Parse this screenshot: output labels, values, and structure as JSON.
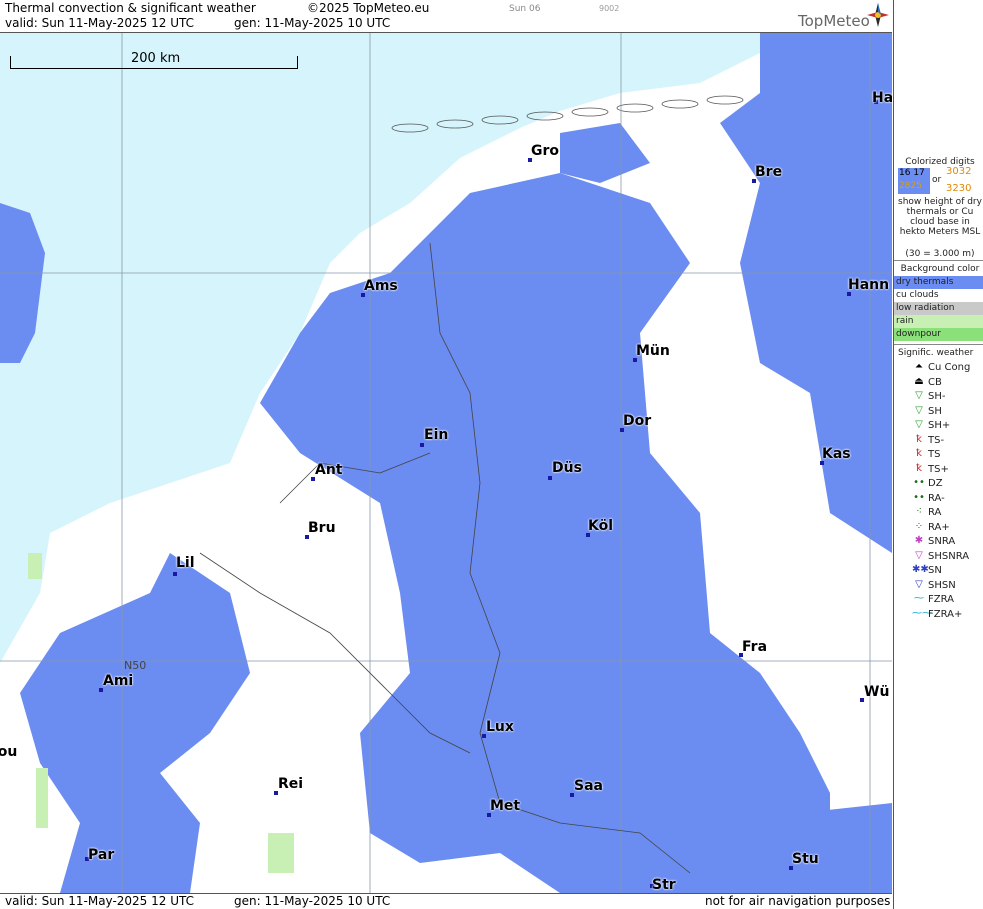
{
  "header": {
    "title": "Thermal convection & significant weather",
    "copyright": "©2025 TopMeteo.eu",
    "run": "Sun 06",
    "code": "9002",
    "valid": "valid:  Sun  11-May-2025  12 UTC",
    "generated": "gen: 11-May-2025 10 UTC"
  },
  "footer": {
    "valid": "valid:  Sun  11-May-2025  12 UTC",
    "generated": "gen: 11-May-2025 10 UTC",
    "disclaimer": "not for air navigation purposes"
  },
  "brand": {
    "name": "TopMeteo"
  },
  "scale": {
    "label": "200 km"
  },
  "map": {
    "grid_label": "N50",
    "cities": [
      {
        "name": "Ham"
      },
      {
        "name": "Gro"
      },
      {
        "name": "Bre"
      },
      {
        "name": "Ams"
      },
      {
        "name": "Hann"
      },
      {
        "name": "Mün"
      },
      {
        "name": "Ein"
      },
      {
        "name": "Dor"
      },
      {
        "name": "Ant"
      },
      {
        "name": "Düs"
      },
      {
        "name": "Kas"
      },
      {
        "name": "Bru"
      },
      {
        "name": "Köl"
      },
      {
        "name": "Lil"
      },
      {
        "name": "Fra"
      },
      {
        "name": "Ami"
      },
      {
        "name": "Lux"
      },
      {
        "name": "Wü"
      },
      {
        "name": "Rei"
      },
      {
        "name": "Saa"
      },
      {
        "name": "Met"
      },
      {
        "name": "Rou"
      },
      {
        "name": "Par"
      },
      {
        "name": "Stu"
      },
      {
        "name": "Str"
      }
    ]
  },
  "legend": {
    "colorized_title": "Colorized digits",
    "sample_left_top": "16 17",
    "sample_left_bottom": "2825",
    "sample_or": "or",
    "sample_right_top": "3032",
    "sample_right_bottom": "3230",
    "description": "show height of dry thermals or Cu cloud base in hekto Meters MSL",
    "example": "(30 = 3.000 m)",
    "background_title": "Background color",
    "backgrounds": [
      {
        "label": "dry thermals",
        "color": "#6b8cf0"
      },
      {
        "label": "cu clouds",
        "color": "#ffffff"
      },
      {
        "label": "low radiation",
        "color": "#c9c9c9"
      },
      {
        "label": "rain",
        "color": "#c8f0b4"
      },
      {
        "label": "downpour",
        "color": "#8ce07a"
      }
    ],
    "weather_title": "Signific. weather",
    "weather": [
      {
        "code": "Cu Cong",
        "icon": "cu-cong-icon",
        "glyph": "⏶",
        "color": "#000000"
      },
      {
        "code": "CB",
        "icon": "cb-icon",
        "glyph": "⏏",
        "color": "#000000"
      },
      {
        "code": "SH-",
        "icon": "shower-light-icon",
        "glyph": "▽",
        "color": "#2ca02c"
      },
      {
        "code": "SH",
        "icon": "shower-icon",
        "glyph": "▽",
        "color": "#2ca02c"
      },
      {
        "code": "SH+",
        "icon": "shower-heavy-icon",
        "glyph": "▽",
        "color": "#2ca02c"
      },
      {
        "code": "TS-",
        "icon": "thunderstorm-light-icon",
        "glyph": "ꝁ",
        "color": "#d62728"
      },
      {
        "code": "TS",
        "icon": "thunderstorm-icon",
        "glyph": "ꝁ",
        "color": "#d62728"
      },
      {
        "code": "TS+",
        "icon": "thunderstorm-heavy-icon",
        "glyph": "ꝁ",
        "color": "#d62728"
      },
      {
        "code": "DZ",
        "icon": "drizzle-icon",
        "glyph": "••",
        "color": "#1a6e1a"
      },
      {
        "code": "RA-",
        "icon": "rain-light-icon",
        "glyph": "••",
        "color": "#1a6e1a"
      },
      {
        "code": "RA",
        "icon": "rain-icon",
        "glyph": "⁖",
        "color": "#1a6e1a"
      },
      {
        "code": "RA+",
        "icon": "rain-heavy-icon",
        "glyph": "⁘",
        "color": "#1a6e1a"
      },
      {
        "code": "SNRA",
        "icon": "sleet-icon",
        "glyph": "✱",
        "color": "#c040c0"
      },
      {
        "code": "SHSNRA",
        "icon": "sleet-shower-icon",
        "glyph": "▽",
        "color": "#c040c0"
      },
      {
        "code": "SN",
        "icon": "snow-icon",
        "glyph": "✱✱",
        "color": "#3040c0"
      },
      {
        "code": "SHSN",
        "icon": "snow-shower-icon",
        "glyph": "▽",
        "color": "#3040c0"
      },
      {
        "code": "FZRA",
        "icon": "freezing-rain-icon",
        "glyph": "⁓",
        "color": "#20b0d0"
      },
      {
        "code": "FZRA+",
        "icon": "freezing-rain-heavy-icon",
        "glyph": "⁓⁓",
        "color": "#20b0d0"
      }
    ]
  },
  "colors": {
    "sea": "#d6f4fb",
    "dry_thermals": "#6b8cf0",
    "cu_clouds": "#ffffff",
    "rain": "#c8f0b4",
    "border": "#555555"
  }
}
